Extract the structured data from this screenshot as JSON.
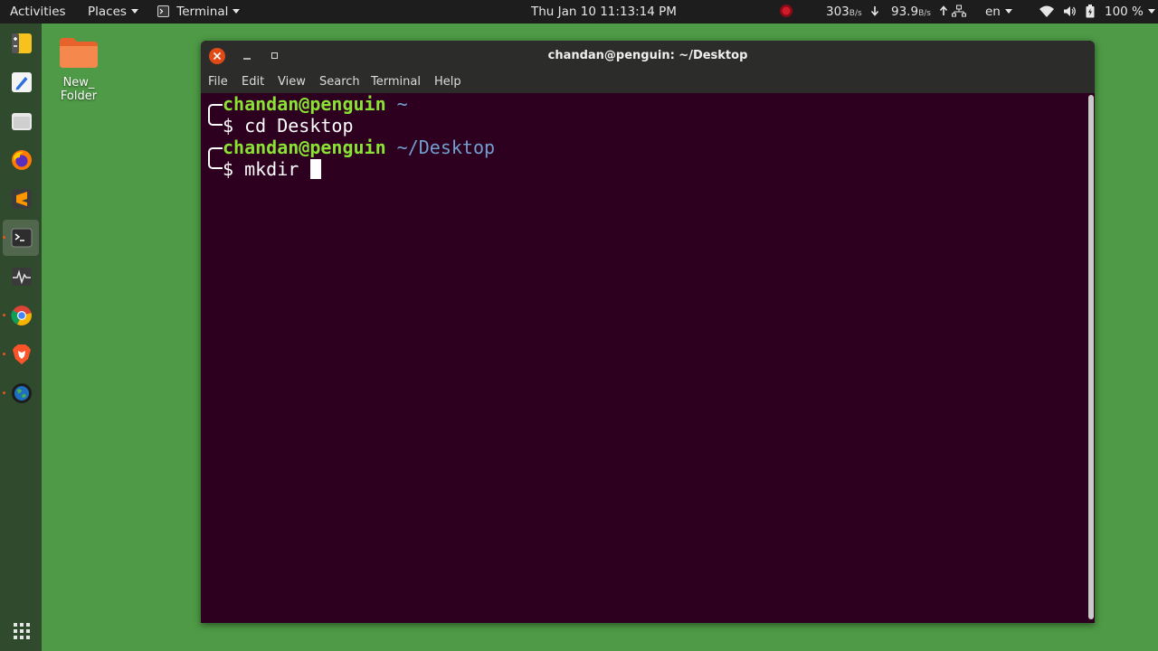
{
  "top_panel": {
    "activities": "Activities",
    "places": "Places",
    "terminal_app": "Terminal",
    "clock": "Thu Jan 10  11:13:14 PM",
    "net_down_value": "303",
    "net_down_unit": "B/s",
    "net_up_value": "93.9",
    "net_up_unit": "B/s",
    "language": "en",
    "battery": "100 %"
  },
  "desktop": {
    "folder_label_line1": "New_",
    "folder_label_line2": "Folder"
  },
  "dock": {
    "items": [
      "text-editor-icon",
      "notes-icon",
      "files-icon",
      "firefox-icon",
      "sublime-icon",
      "terminal-icon",
      "system-monitor-icon",
      "chrome-icon",
      "brave-icon",
      "globe-icon"
    ],
    "show_apps": "app-grid-icon"
  },
  "terminal": {
    "title": "chandan@penguin: ~/Desktop",
    "menu": [
      "File",
      "Edit",
      "View",
      "Search",
      "Terminal",
      "Help"
    ],
    "lines": [
      {
        "user": "chandan@penguin",
        "path": "~"
      },
      {
        "prompt": "$",
        "command": "cd Desktop"
      },
      {
        "user": "chandan@penguin",
        "path": "~/Desktop"
      },
      {
        "prompt": "$",
        "command": "mkdir "
      }
    ]
  },
  "colors": {
    "desktop_bg": "#4e9a46",
    "terminal_bg": "#2c001e",
    "prompt_user": "#8ae234",
    "prompt_path": "#729fcf",
    "close_button": "#df4a16"
  }
}
